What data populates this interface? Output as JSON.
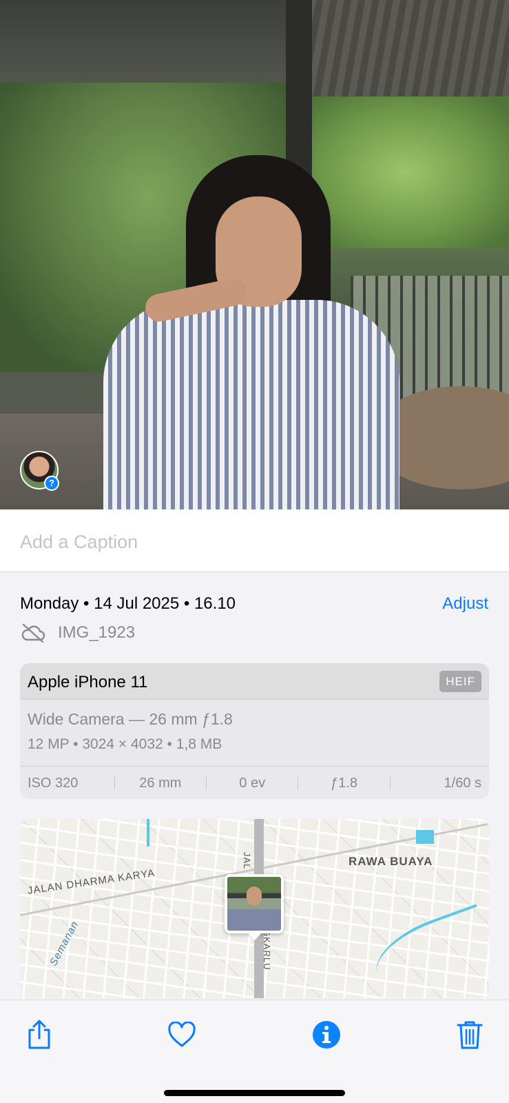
{
  "photo": {
    "face_badge": "?"
  },
  "caption": {
    "placeholder": "Add a Caption"
  },
  "info": {
    "date_time": "Monday • 14 Jul 2025 • 16.10",
    "adjust_label": "Adjust",
    "file_name": "IMG_1923",
    "cloud_icon": "cloud-slash-icon"
  },
  "device_card": {
    "device": "Apple iPhone 11",
    "format_badge": "HEIF",
    "lens": "Wide Camera — 26 mm ƒ1.8",
    "specs": "12 MP  •  3024 × 4032  •  1,8 MB",
    "exif": [
      "ISO 320",
      "26 mm",
      "0 ev",
      "ƒ1.8",
      "1/60 s"
    ]
  },
  "map": {
    "labels": {
      "rawa_buaya": "RAWA BUAYA",
      "dharma_karya": "JALAN DHARMA KARYA",
      "semanan": "Semanan",
      "jal": "JAL",
      "gkarlu": "GKARLU"
    }
  },
  "toolbar": {
    "share_icon": "share-icon",
    "favorite_icon": "heart-icon",
    "info_icon": "info-icon",
    "delete_icon": "trash-icon"
  },
  "colors": {
    "accent": "#0a7aff",
    "info_active": "#0a84ff"
  }
}
